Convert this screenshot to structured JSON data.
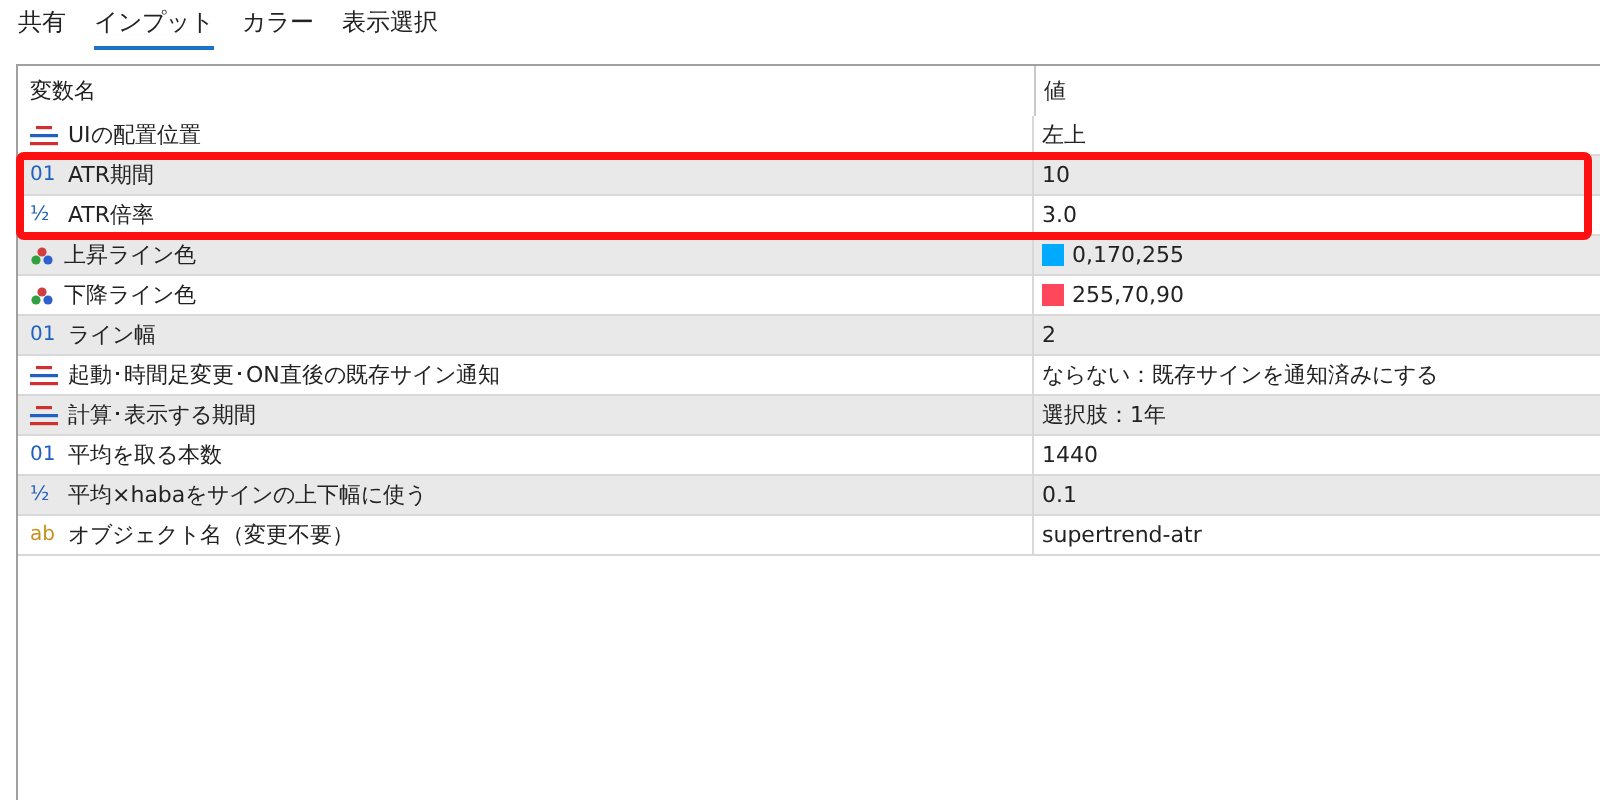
{
  "tabs": [
    {
      "label": "共有",
      "selected": false
    },
    {
      "label": "インプット",
      "selected": true
    },
    {
      "label": "カラー",
      "selected": false
    },
    {
      "label": "表示選択",
      "selected": false
    }
  ],
  "table": {
    "columns": [
      "変数名",
      "値"
    ],
    "rows": [
      {
        "kind": "enum",
        "name": "UIの配置位置",
        "value": "左上"
      },
      {
        "kind": "int",
        "icon_text": "01",
        "name": "ATR期間",
        "value": "10"
      },
      {
        "kind": "double",
        "icon_text": "½",
        "name": "ATR倍率",
        "value": "3.0"
      },
      {
        "kind": "color",
        "name": "上昇ライン色",
        "value": "0,170,255",
        "color": "#00aaff"
      },
      {
        "kind": "color",
        "name": "下降ライン色",
        "value": "255,70,90",
        "color": "#ff465a"
      },
      {
        "kind": "int",
        "icon_text": "01",
        "name": "ライン幅",
        "value": "2"
      },
      {
        "kind": "enum",
        "name": "起動･時間足変更･ON直後の既存サイン通知",
        "value": "ならない：既存サインを通知済みにする"
      },
      {
        "kind": "enum",
        "name": "計算･表示する期間",
        "value": "選択肢：1年"
      },
      {
        "kind": "int",
        "icon_text": "01",
        "name": "平均を取る本数",
        "value": "1440"
      },
      {
        "kind": "double",
        "icon_text": "½",
        "name": "平均×habaをサインの上下幅に使う",
        "value": "0.1"
      },
      {
        "kind": "string",
        "icon_text": "ab",
        "name": "オブジェクト名（変更不要）",
        "value": "supertrend-atr"
      }
    ]
  }
}
